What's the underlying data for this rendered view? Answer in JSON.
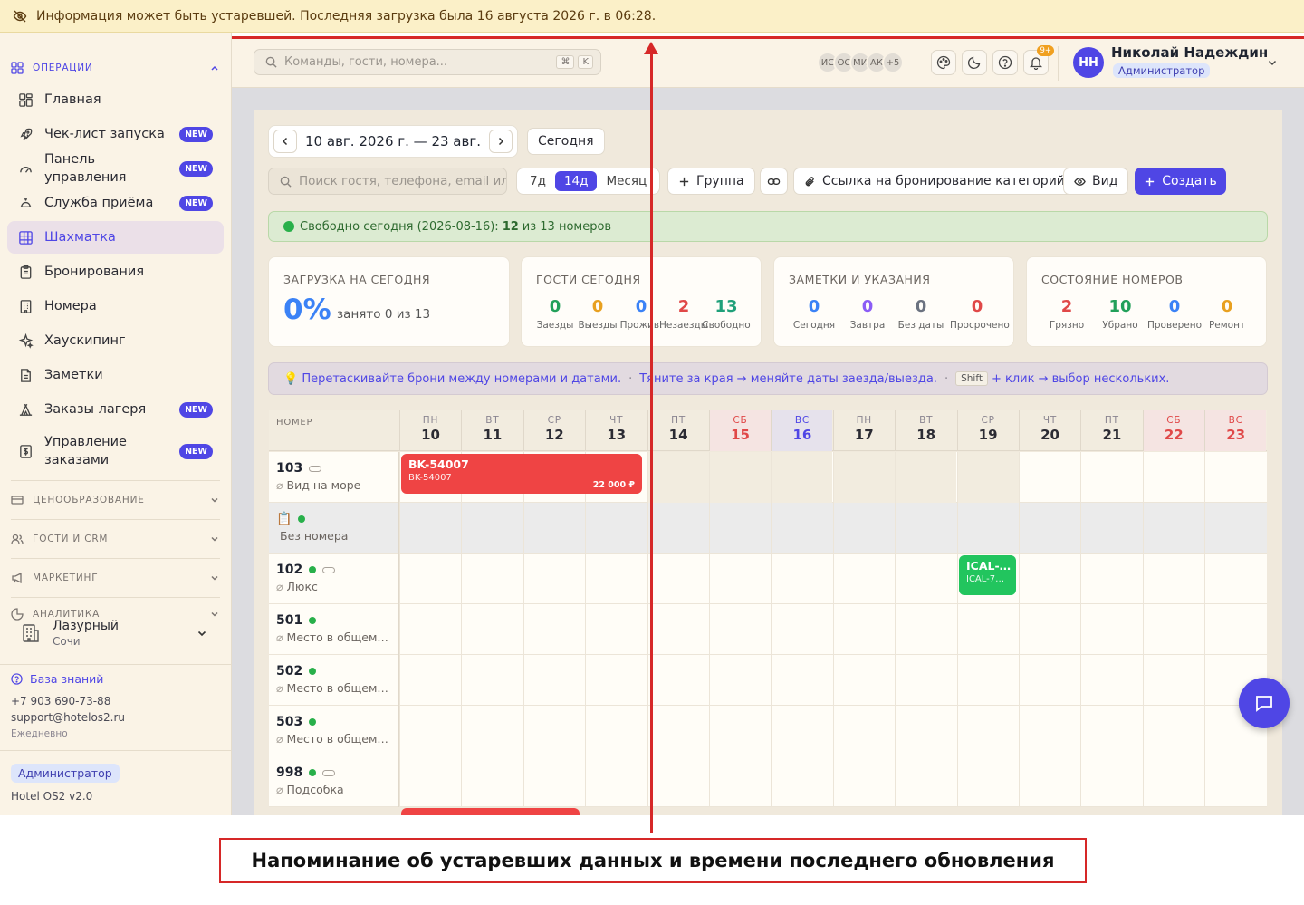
{
  "banner": {
    "text": "Информация может быть устаревшей. Последняя загрузка была 16 августа 2026 г. в 06:28.",
    "icon": "eye-off-icon"
  },
  "sidebar": {
    "sections": {
      "operations": "ОПЕРАЦИИ",
      "pricing": "ЦЕНООБРАЗОВАНИЕ",
      "guests": "ГОСТИ И CRM",
      "marketing": "МАРКЕТИНГ",
      "analytics": "АНАЛИТИКА"
    },
    "items": [
      {
        "label": "Главная",
        "icon": "dashboard-icon",
        "badge": ""
      },
      {
        "label": "Чек-лист запуска",
        "icon": "rocket-icon",
        "badge": "NEW"
      },
      {
        "label": "Панель управления",
        "icon": "gauge-icon",
        "badge": "NEW"
      },
      {
        "label": "Служба приёма",
        "icon": "bell-desk-icon",
        "badge": "NEW"
      },
      {
        "label": "Шахматка",
        "icon": "grid-icon",
        "badge": ""
      },
      {
        "label": "Бронирования",
        "icon": "clipboard-icon",
        "badge": ""
      },
      {
        "label": "Номера",
        "icon": "building-icon",
        "badge": ""
      },
      {
        "label": "Хаускипинг",
        "icon": "sparkles-icon",
        "badge": ""
      },
      {
        "label": "Заметки",
        "icon": "note-icon",
        "badge": ""
      },
      {
        "label": "Заказы лагеря",
        "icon": "tent-icon",
        "badge": "NEW"
      },
      {
        "label": "Управление заказами",
        "icon": "dollar-icon",
        "badge": "NEW"
      }
    ],
    "new_badge": "NEW",
    "hotel": {
      "name": "Лазурный",
      "city": "Сочи"
    },
    "footer": {
      "kb_link": "База знаний",
      "phone": "+7 903 690-73-88",
      "email": "support@hotelos2.ru",
      "hours": "Ежедневно",
      "role": "Администратор",
      "version": "Hotel OS2 v2.0"
    }
  },
  "topbar": {
    "search_placeholder": "Команды, гости, номера...",
    "kbd1": "⌘",
    "kbd2": "K",
    "avatars": [
      "ИС",
      "ОС",
      "МИ",
      "АК",
      "+5"
    ],
    "notif_count": "9+",
    "user": {
      "initials": "НН",
      "name": "Николай Надеждин",
      "role": "Администратор"
    }
  },
  "toolbar": {
    "date_range": "10 авг. 2026 г. — 23 авг.",
    "today": "Сегодня",
    "guest_search_placeholder": "Поиск гостя, телефона, email или",
    "periods": [
      "7д",
      "14д",
      "Месяц"
    ],
    "active_period": "14д",
    "group": "Группа",
    "booking_link": "Ссылка на бронирование категорий",
    "view": "Вид",
    "create": "Создать"
  },
  "free_bar": {
    "prefix": "Свободно сегодня (2026-08-16):",
    "free": "12",
    "suffix": "из 13 номеров"
  },
  "cards": {
    "load": {
      "title": "ЗАГРУЗКА НА СЕГОДНЯ",
      "pct": "0%",
      "text": "занято 0 из 13"
    },
    "guests": {
      "title": "ГОСТИ СЕГОДНЯ",
      "stats": [
        {
          "n": "0",
          "l": "Заезды",
          "color": "#22a05a"
        },
        {
          "n": "0",
          "l": "Выезды",
          "color": "#e8a020"
        },
        {
          "n": "0",
          "l": "Прожив.",
          "color": "#3b82f6"
        },
        {
          "n": "2",
          "l": "Незаезды",
          "color": "#e04848"
        },
        {
          "n": "13",
          "l": "Свободно",
          "color": "#1fa07a"
        }
      ]
    },
    "notes": {
      "title": "ЗАМЕТКИ И УКАЗАНИЯ",
      "stats": [
        {
          "n": "0",
          "l": "Сегодня",
          "color": "#3b82f6"
        },
        {
          "n": "0",
          "l": "Завтра",
          "color": "#8b5cf6"
        },
        {
          "n": "0",
          "l": "Без даты",
          "color": "#6b7280"
        },
        {
          "n": "0",
          "l": "Просрочено",
          "color": "#e04848"
        }
      ]
    },
    "rooms": {
      "title": "СОСТОЯНИЕ НОМЕРОВ",
      "stats": [
        {
          "n": "2",
          "l": "Грязно",
          "color": "#e04848"
        },
        {
          "n": "10",
          "l": "Убрано",
          "color": "#22a05a"
        },
        {
          "n": "0",
          "l": "Проверено",
          "color": "#3b82f6"
        },
        {
          "n": "0",
          "l": "Ремонт",
          "color": "#e8a020"
        }
      ]
    }
  },
  "hint": {
    "part1": "💡 Перетаскивайте брони между номерами и датами.",
    "part2": "Тяните за края → меняйте даты заезда/выезда.",
    "kbd": "Shift",
    "part3": "+ клик → выбор нескольких."
  },
  "grid": {
    "room_header": "НОМЕР",
    "days": [
      {
        "dw": "ПН",
        "dn": "10",
        "kind": ""
      },
      {
        "dw": "ВТ",
        "dn": "11",
        "kind": ""
      },
      {
        "dw": "СР",
        "dn": "12",
        "kind": ""
      },
      {
        "dw": "ЧТ",
        "dn": "13",
        "kind": ""
      },
      {
        "dw": "ПТ",
        "dn": "14",
        "kind": ""
      },
      {
        "dw": "СБ",
        "dn": "15",
        "kind": "weekend"
      },
      {
        "dw": "ВС",
        "dn": "16",
        "kind": "today"
      },
      {
        "dw": "ПН",
        "dn": "17",
        "kind": ""
      },
      {
        "dw": "ВТ",
        "dn": "18",
        "kind": ""
      },
      {
        "dw": "СР",
        "dn": "19",
        "kind": ""
      },
      {
        "dw": "ЧТ",
        "dn": "20",
        "kind": ""
      },
      {
        "dw": "ПТ",
        "dn": "21",
        "kind": ""
      },
      {
        "dw": "СБ",
        "dn": "22",
        "kind": "weekend"
      },
      {
        "dw": "ВС",
        "dn": "23",
        "kind": "weekend"
      }
    ],
    "rows": [
      {
        "no": "103",
        "type": "Вид на море",
        "dot": false,
        "pill": true
      },
      {
        "no": "📋",
        "type": "Без номера",
        "dot": true,
        "pill": false
      },
      {
        "no": "102",
        "type": "Люкс",
        "dot": true,
        "pill": true
      },
      {
        "no": "501",
        "type": "Место в общем …",
        "dot": true,
        "pill": false
      },
      {
        "no": "502",
        "type": "Место в общем …",
        "dot": true,
        "pill": false
      },
      {
        "no": "503",
        "type": "Место в общем …",
        "dot": true,
        "pill": false
      },
      {
        "no": "998",
        "type": "Подсобка",
        "dot": true,
        "pill": true
      }
    ],
    "bookings": [
      {
        "title": "BK-54007",
        "sub": "BK-54007",
        "price": "22 000 ₽",
        "color": "#ef4444"
      },
      {
        "title": "ICAL-…",
        "sub": "ICAL-7…",
        "price": "",
        "color": "#22c55e"
      }
    ]
  },
  "caption": "Напоминание об устаревших данных и времени последнего обновления"
}
